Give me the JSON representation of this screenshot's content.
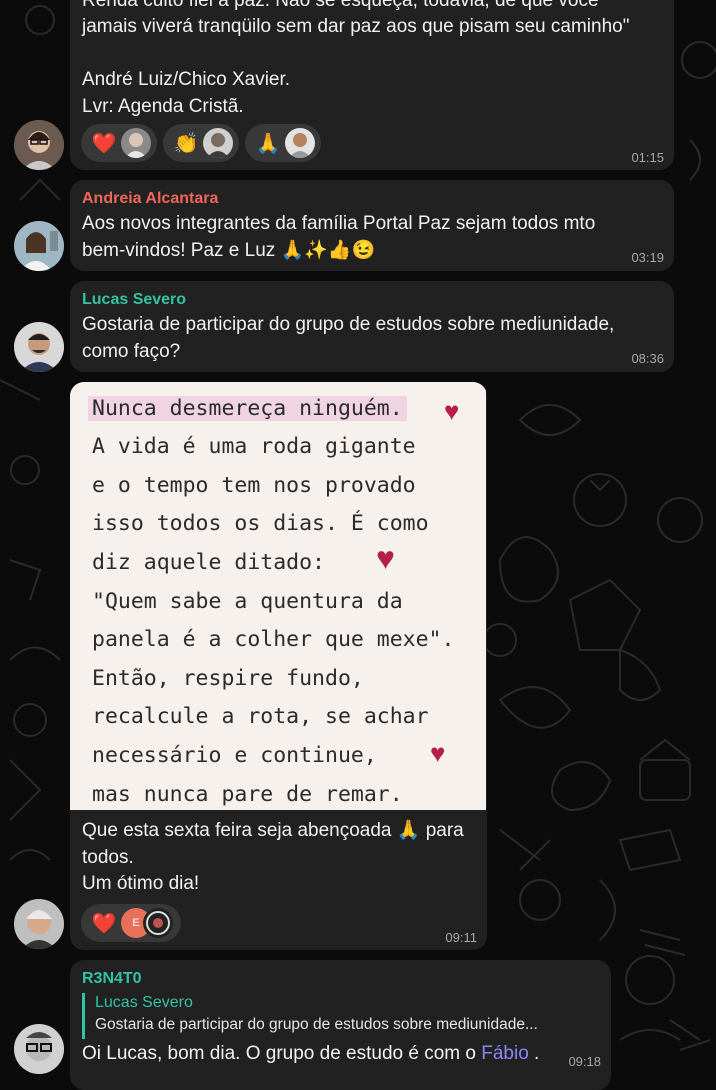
{
  "messages": {
    "m1": {
      "partial_line_top": "Renda culto fiel à paz. Não se esqueça, todavia, de que você",
      "text": "jamais viverá tranqüilo sem dar paz aos que pisam seu caminho\"\n\nAndré Luiz/Chico Xavier.\nLvr: Agenda Cristã.",
      "time": "01:15",
      "reactions": [
        {
          "emoji": "❤️",
          "icon": "heart-icon"
        },
        {
          "emoji": "👏",
          "icon": "clapping-hands-icon"
        },
        {
          "emoji": "🙏",
          "icon": "folded-hands-icon"
        }
      ]
    },
    "m2": {
      "sender": "Andreia Alcantara",
      "sender_color": "#f0665b",
      "text": "Aos novos integrantes da família Portal Paz sejam todos mto bem-vindos! Paz e Luz 🙏✨👍😉",
      "time": "03:19"
    },
    "m3": {
      "sender": "Lucas Severo",
      "sender_color": "#31c3a6",
      "text": "Gostaria de participar do grupo de estudos sobre mediunidade, como faço?",
      "time": "08:36"
    },
    "m4": {
      "image_lines": [
        "Nunca desmereça ninguém.",
        "A vida é uma roda gigante",
        "e o tempo tem nos provado",
        "isso todos os dias. É como",
        "diz aquele ditado:",
        "\"Quem sabe a quentura da",
        "panela é a colher que mexe\".",
        "Então, respire fundo,",
        "recalcule a rota, se achar",
        "necessário e continue,",
        "mas nunca pare de remar."
      ],
      "text": "Que esta sexta feira seja abençoada 🙏 para todos.\nUm ótimo dia!",
      "time": "09:11",
      "reaction_emoji": "❤️",
      "reaction_avatar_letter": "E"
    },
    "m5": {
      "sender": "R3N4T0",
      "sender_color": "#31c3a6",
      "reply_sender": "Lucas Severo",
      "reply_text": "Gostaria de participar do grupo de estudos sobre mediunidade...",
      "text_prefix": "Oi Lucas, bom dia. O grupo de estudo é com o ",
      "mention": "Fábio",
      "text_suffix": " .",
      "time": "09:18"
    }
  }
}
